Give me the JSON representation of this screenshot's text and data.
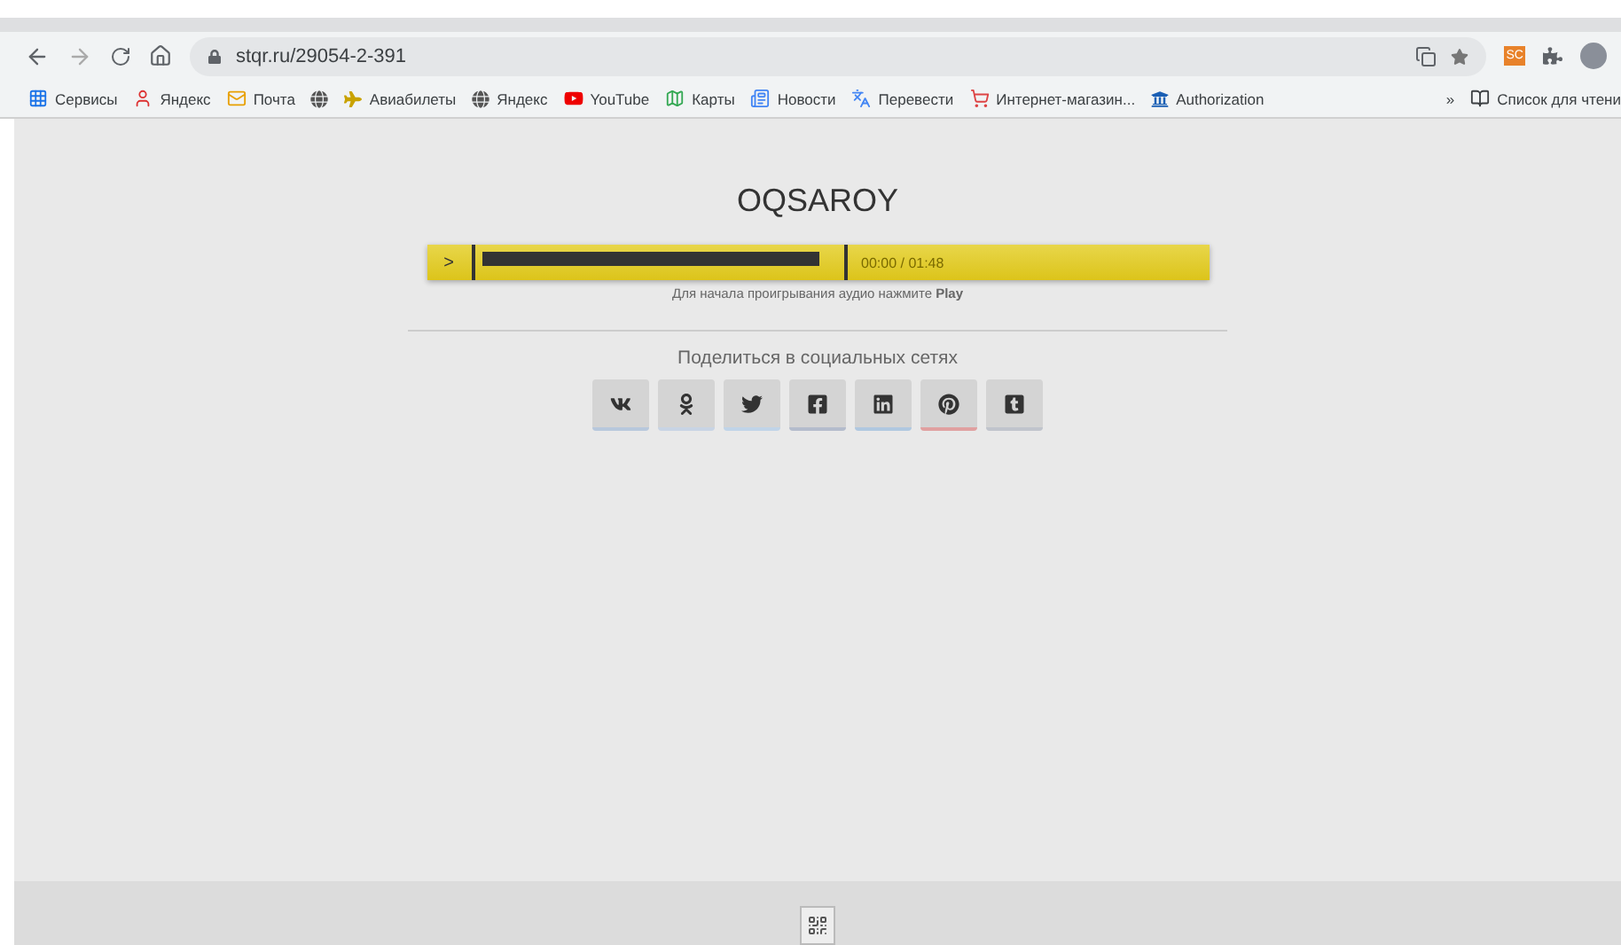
{
  "browser": {
    "url": "stqr.ru/29054-2-391",
    "extension_badge": "SC",
    "bookmarks": [
      {
        "label": "Сервисы",
        "kind": "apps"
      },
      {
        "label": "Яндекс",
        "kind": "yandex"
      },
      {
        "label": "Почта",
        "kind": "mail"
      },
      {
        "kind": "globe"
      },
      {
        "label": "Авиабилеты",
        "kind": "plane"
      },
      {
        "label": "Яндекс",
        "kind": "globe"
      },
      {
        "label": "YouTube",
        "kind": "youtube"
      },
      {
        "label": "Карты",
        "kind": "maps"
      },
      {
        "label": "Новости",
        "kind": "news"
      },
      {
        "label": "Перевести",
        "kind": "translate"
      },
      {
        "label": "Интернет-магазин...",
        "kind": "shop"
      },
      {
        "label": "Authorization",
        "kind": "bank"
      }
    ],
    "overflow": "»",
    "reading_list": "Список для чтени"
  },
  "page": {
    "title": "OQSAROY",
    "player": {
      "play": ">",
      "level": 0.95,
      "time": "00:00 / 01:48",
      "hint": "Для начала проигрывания аудио нажмите **Play**"
    },
    "share_title": "Поделиться в социальных сетях",
    "share_buttons": [
      {
        "kind": "vk",
        "color": "#b8c8dc"
      },
      {
        "kind": "ok",
        "color": "#c8d4e4"
      },
      {
        "kind": "twitter",
        "color": "#c0d4e8"
      },
      {
        "kind": "facebook",
        "color": "#b4bccc"
      },
      {
        "kind": "linkedin",
        "color": "#b0c8e0"
      },
      {
        "kind": "pinterest",
        "color": "#e0a0a0"
      },
      {
        "kind": "tumblr",
        "color": "#c0c4cc"
      }
    ]
  }
}
